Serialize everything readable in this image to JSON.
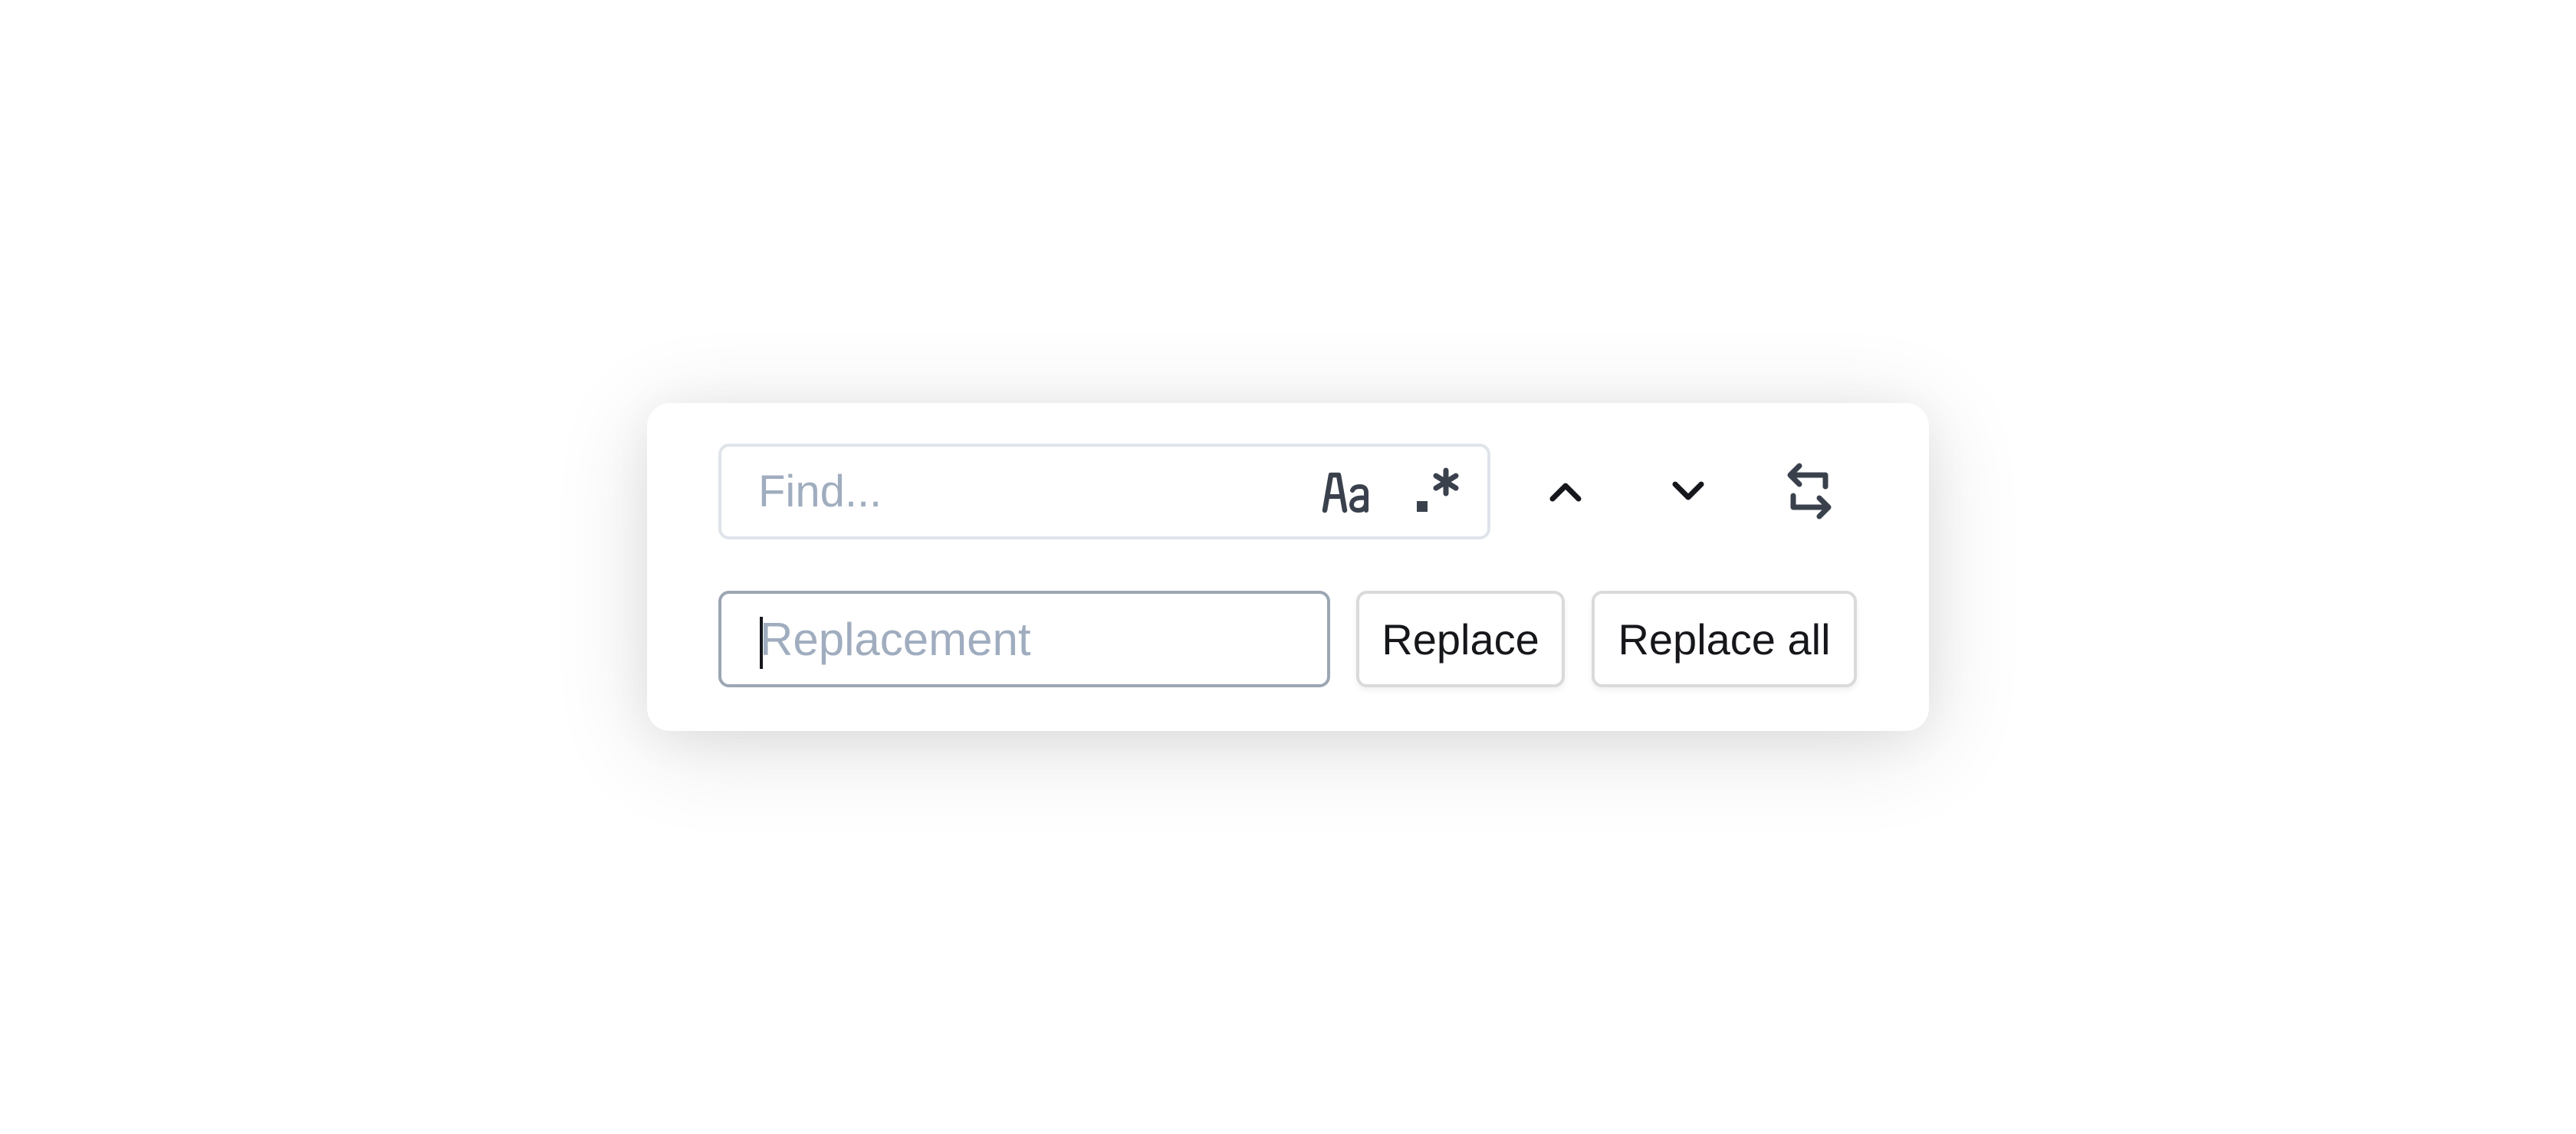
{
  "find": {
    "placeholder": "Find...",
    "value": "",
    "options": [
      {
        "name": "match-case",
        "label": "Aa",
        "icon": "match-case-icon"
      },
      {
        "name": "regex",
        "label": ".*",
        "icon": "regex-icon"
      }
    ]
  },
  "navigation": {
    "previous_icon": "chevron-up-icon",
    "next_icon": "chevron-down-icon",
    "toggle_replace_icon": "swap-arrows-icon"
  },
  "replace": {
    "placeholder": "Replacement",
    "value": "",
    "replace_label": "Replace",
    "replace_all_label": "Replace all"
  },
  "colors": {
    "placeholder": "#a0adbf",
    "icon_dark": "#3a414d",
    "chevron": "#15171c",
    "find_border": "#dfe4eb",
    "replace_border_focused": "#9ca6b3",
    "button_border": "#dadada"
  }
}
